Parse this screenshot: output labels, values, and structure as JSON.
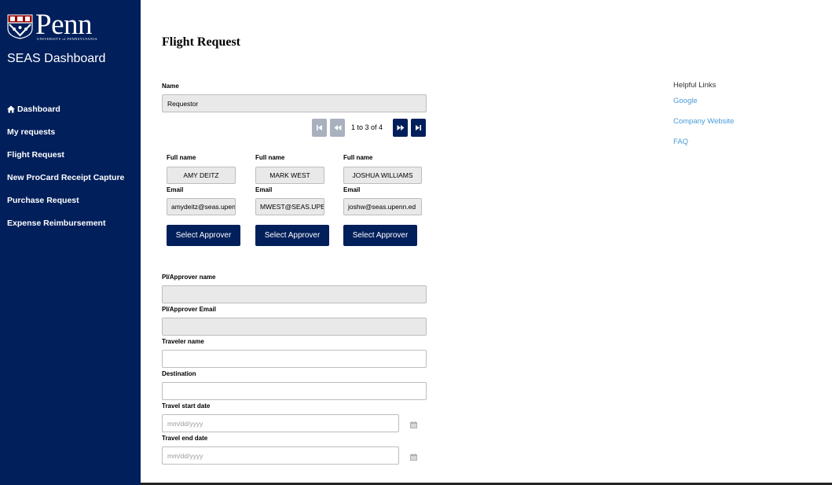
{
  "sidebar": {
    "logo_word": "Penn",
    "logo_sub": "UNIVERSITY of PENNSYLVANIA",
    "app_title": "SEAS Dashboard",
    "items": [
      {
        "label": "Dashboard",
        "icon": "home-icon"
      },
      {
        "label": "My requests"
      },
      {
        "label": "Flight Request"
      },
      {
        "label": "New ProCard Receipt Capture"
      },
      {
        "label": "Purchase Request"
      },
      {
        "label": "Expense Reimbursement"
      }
    ]
  },
  "main": {
    "title": "Flight Request",
    "name_label": "Name",
    "name_value": "Requestor",
    "pager_text": "1 to 3 of 4",
    "approvers": [
      {
        "name_label": "Full name",
        "name": "AMY DEITZ",
        "email_label": "Email",
        "email": "amydeitz@seas.upenn",
        "button": "Select Approver"
      },
      {
        "name_label": "Full name",
        "name": "MARK WEST",
        "email_label": "Email",
        "email": "MWEST@SEAS.UPEI",
        "button": "Select Approver"
      },
      {
        "name_label": "Full name",
        "name": "JOSHUA WILLIAMS",
        "email_label": "Email",
        "email": "joshw@seas.upenn.ed",
        "button": "Select Approver"
      }
    ],
    "pi_name_label": "PI/Approver name",
    "pi_email_label": "PI/Approver Email",
    "traveler_label": "Traveler name",
    "destination_label": "Destination",
    "start_label": "Travel start date",
    "start_placeholder": "mm/dd/yyyy",
    "end_label": "Travel end date",
    "end_placeholder": "mm/dd/yyyy"
  },
  "links": {
    "heading": "Helpful Links",
    "items": [
      "Google",
      "Company Website",
      "FAQ"
    ]
  },
  "colors": {
    "brand_navy": "#011f5b",
    "link_blue": "#4a9ad6",
    "disabled_btn": "#a9b1bf"
  }
}
